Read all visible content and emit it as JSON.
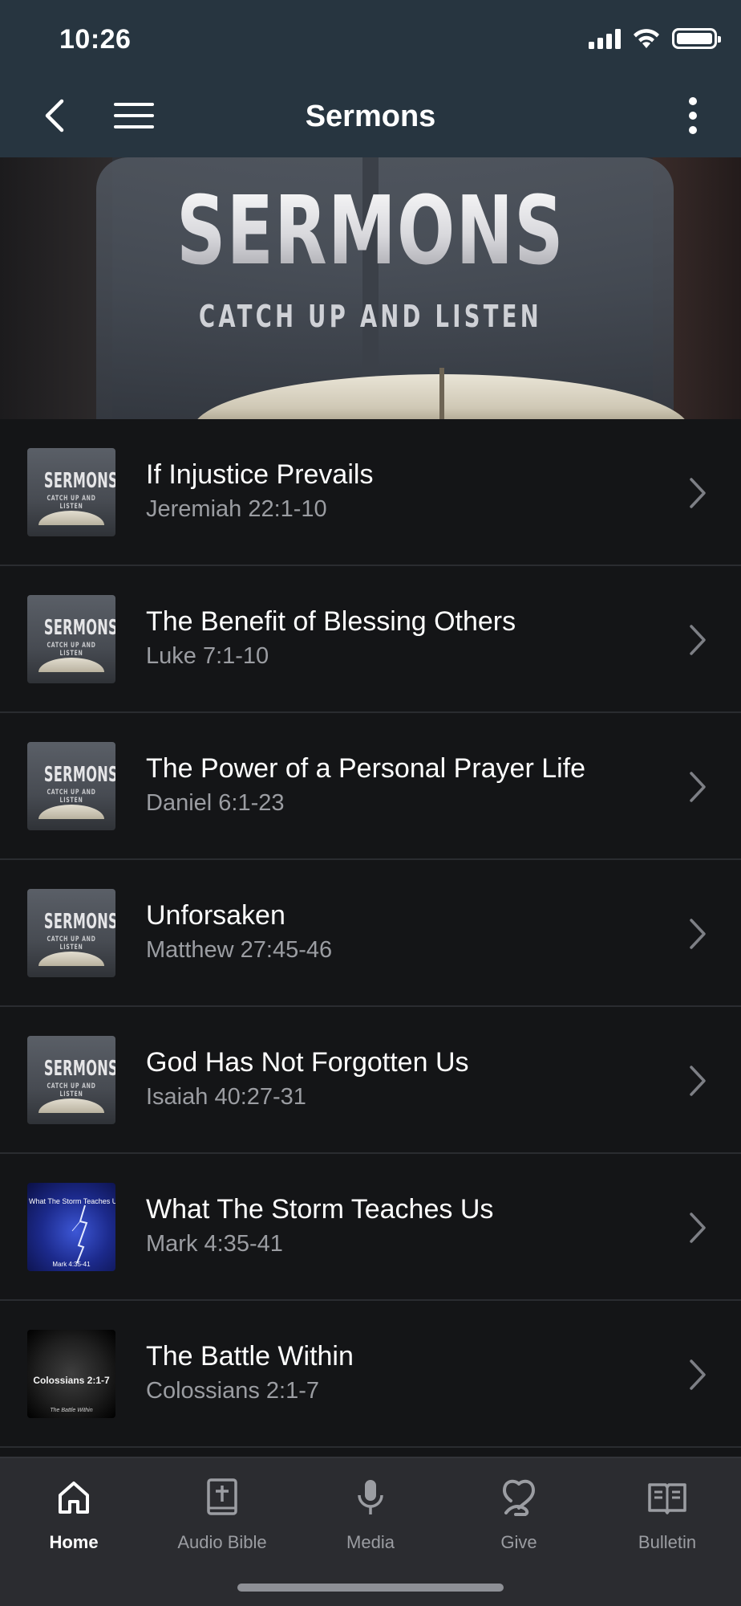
{
  "status_bar": {
    "time": "10:26"
  },
  "nav": {
    "title": "Sermons"
  },
  "hero": {
    "title": "SERMONS",
    "subtitle": "CATCH UP AND LISTEN"
  },
  "thumb_text": {
    "series_title": "SERMONS",
    "series_sub": "CATCH UP AND LISTEN",
    "storm_caption": "What The Storm Teaches Us",
    "storm_ref": "Mark 4:35-41",
    "battle_ref": "Colossians 2:1-7",
    "battle_sub": "The Battle Within"
  },
  "sermons": [
    {
      "title": "If Injustice Prevails",
      "reference": "Jeremiah 22:1-10",
      "thumb": "series"
    },
    {
      "title": "The Benefit of Blessing Others",
      "reference": "Luke 7:1-10",
      "thumb": "series"
    },
    {
      "title": "The Power of a Personal Prayer Life",
      "reference": "Daniel 6:1-23",
      "thumb": "series"
    },
    {
      "title": "Unforsaken",
      "reference": "Matthew 27:45-46",
      "thumb": "series"
    },
    {
      "title": "God Has Not Forgotten Us",
      "reference": "Isaiah 40:27-31",
      "thumb": "series"
    },
    {
      "title": "What The Storm Teaches Us",
      "reference": "Mark 4:35-41",
      "thumb": "storm"
    },
    {
      "title": "The Battle Within",
      "reference": "Colossians 2:1-7",
      "thumb": "battle"
    }
  ],
  "tabs": [
    {
      "label": "Home",
      "icon": "home-icon",
      "active": true
    },
    {
      "label": "Audio Bible",
      "icon": "bible-icon",
      "active": false
    },
    {
      "label": "Media",
      "icon": "microphone-icon",
      "active": false
    },
    {
      "label": "Give",
      "icon": "give-icon",
      "active": false
    },
    {
      "label": "Bulletin",
      "icon": "open-book-icon",
      "active": false
    }
  ],
  "colors": {
    "nav_bg": "#273540",
    "list_bg": "#141517",
    "tabbar_bg": "#2b2c30",
    "secondary_text": "#9b9da2"
  }
}
